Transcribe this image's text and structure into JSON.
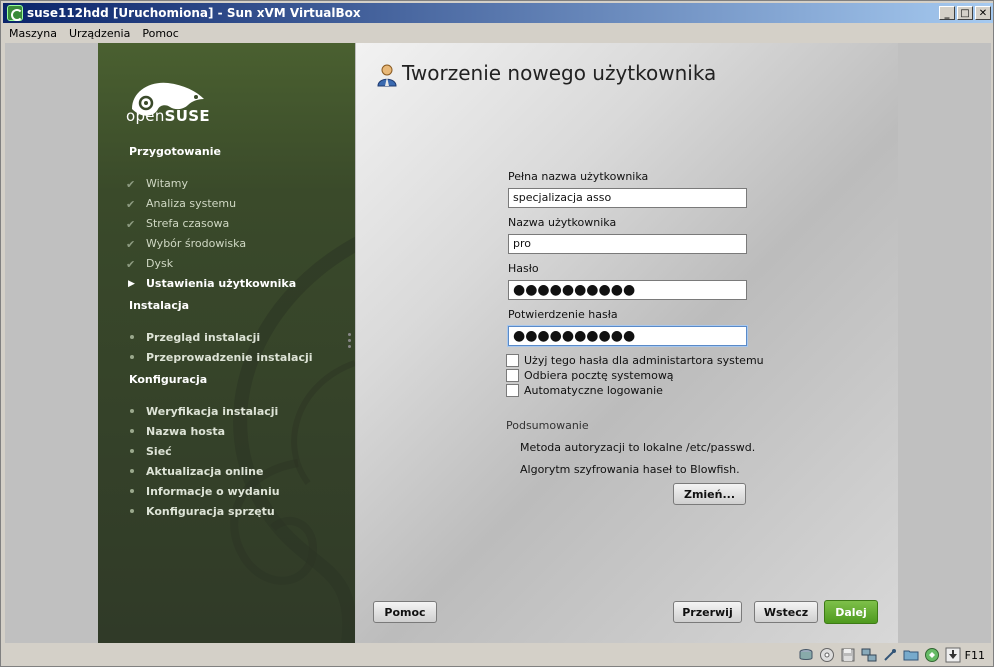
{
  "window": {
    "title": "suse112hdd [Uruchomiona] - Sun xVM VirtualBox",
    "min_label": "_",
    "max_label": "□",
    "close_label": "✕"
  },
  "menubar": {
    "items": [
      "Maszyna",
      "Urządzenia",
      "Pomoc"
    ]
  },
  "sidebar": {
    "logo": {
      "prefix": "open",
      "suffix": "SUSE"
    },
    "sections": [
      {
        "title": "Przygotowanie",
        "steps": [
          {
            "label": "Witamy",
            "state": "done"
          },
          {
            "label": "Analiza systemu",
            "state": "done"
          },
          {
            "label": "Strefa czasowa",
            "state": "done"
          },
          {
            "label": "Wybór środowiska",
            "state": "done"
          },
          {
            "label": "Dysk",
            "state": "done"
          },
          {
            "label": "Ustawienia użytkownika",
            "state": "current"
          }
        ]
      },
      {
        "title": "Instalacja",
        "steps": [
          {
            "label": "Przegląd instalacji",
            "state": "pending"
          },
          {
            "label": "Przeprowadzenie instalacji",
            "state": "pending"
          }
        ]
      },
      {
        "title": "Konfiguracja",
        "steps": [
          {
            "label": "Weryfikacja instalacji",
            "state": "pending"
          },
          {
            "label": "Nazwa hosta",
            "state": "pending"
          },
          {
            "label": "Sieć",
            "state": "pending"
          },
          {
            "label": "Aktualizacja online",
            "state": "pending"
          },
          {
            "label": "Informacje o wydaniu",
            "state": "pending"
          },
          {
            "label": "Konfiguracja sprzętu",
            "state": "pending"
          }
        ]
      }
    ]
  },
  "main": {
    "title": "Tworzenie nowego użytkownika",
    "fields": {
      "full_name": {
        "label": "Pełna nazwa użytkownika",
        "value": "specjalizacja asso"
      },
      "username": {
        "label": "Nazwa użytkownika",
        "value": "pro"
      },
      "password": {
        "label": "Hasło",
        "value": "●●●●●●●●●●"
      },
      "password_confirm": {
        "label": "Potwierdzenie hasła",
        "value": "●●●●●●●●●●"
      }
    },
    "checkboxes": [
      {
        "label": "Użyj tego hasła dla administartora systemu",
        "checked": false
      },
      {
        "label": "Odbiera pocztę systemową",
        "checked": false
      },
      {
        "label": "Automatyczne logowanie",
        "checked": false
      }
    ],
    "summary": {
      "title": "Podsumowanie",
      "lines": [
        "Metoda autoryzacji to lokalne /etc/passwd.",
        "Algorytm szyfrowania haseł to Blowfish."
      ],
      "change_label": "Zmień..."
    },
    "buttons": {
      "help": "Pomoc",
      "abort": "Przerwij",
      "back": "Wstecz",
      "next": "Dalej"
    }
  },
  "statusbar": {
    "host_key": "F11",
    "icons": [
      "hard-disk-icon",
      "cd-icon",
      "floppy-icon",
      "network-icon",
      "usb-icon",
      "shared-folders-icon",
      "mouse-integration-icon",
      "host-key-arrow-icon"
    ]
  },
  "colors": {
    "titlebar_start": "#0a246a",
    "titlebar_end": "#a6caf0",
    "sidebar_green": "#3a4a2a",
    "next_button_green": "#4e9a1e"
  }
}
